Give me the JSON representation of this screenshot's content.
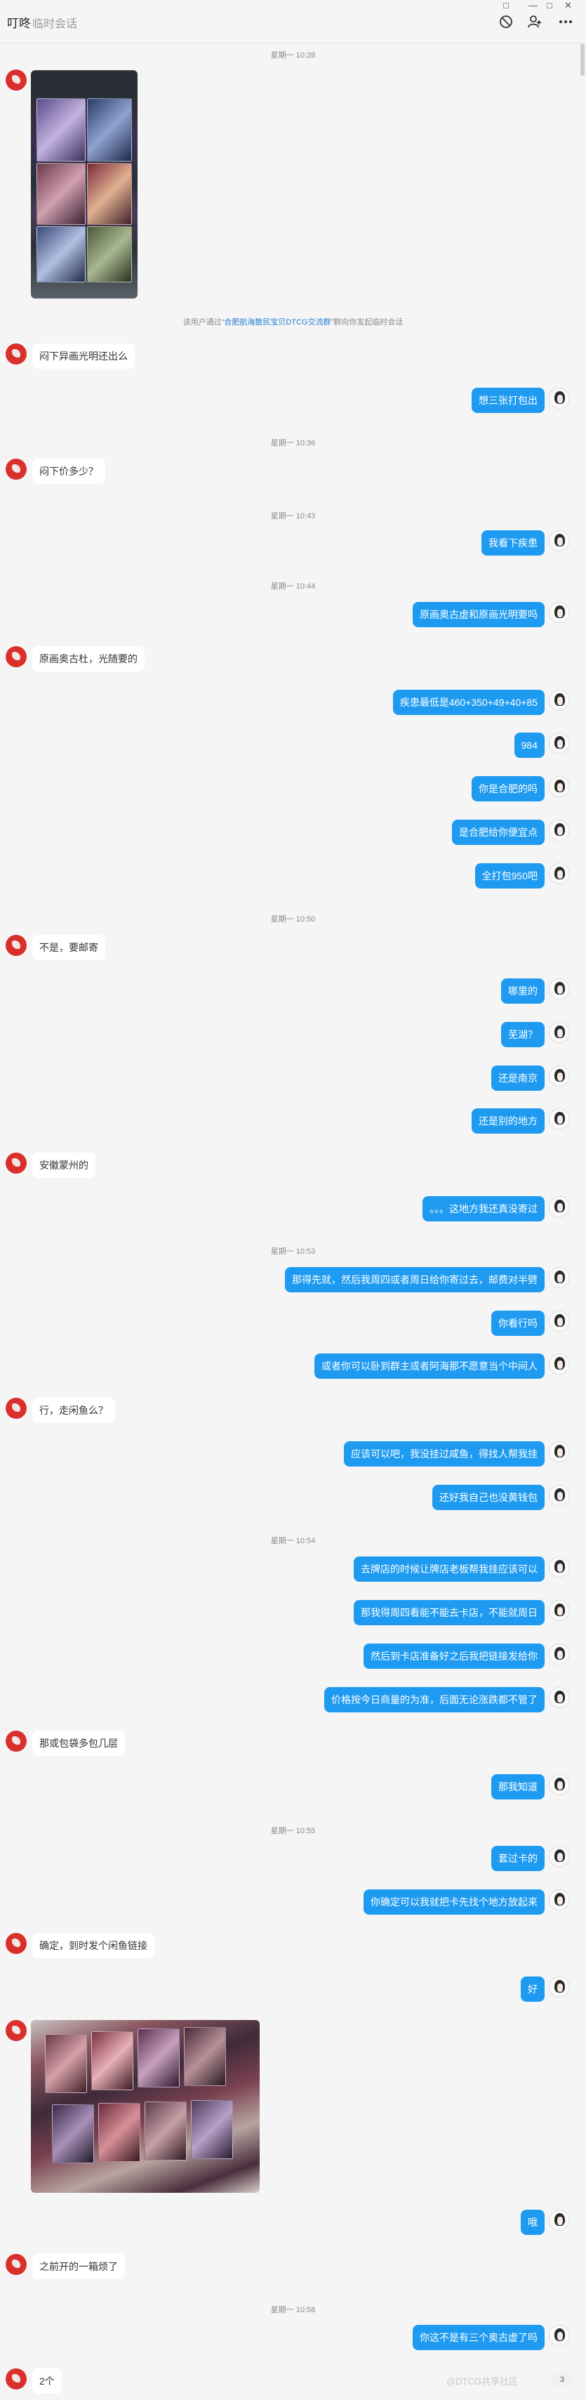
{
  "header": {
    "title": "叮咚",
    "subtitle": "临时会话",
    "window_controls": [
      "□",
      "—",
      "□",
      "✕"
    ]
  },
  "notice": {
    "pre": "该用户通过“",
    "group": "合肥航海散民宝贝DTCG交流群",
    "post": "”群向你发起临时会话"
  },
  "times": [
    "星期一 10:28",
    "星期一 10:36",
    "星期一 10:43",
    "星期一 10:44",
    "星期一 10:50",
    "星期一 10:53",
    "星期一 10:54",
    "星期一 10:55",
    "星期一 10:58"
  ],
  "messages": {
    "m1": "闷下异画光明还出么",
    "m2": "想三张打包出",
    "m3": "闷下价多少？",
    "m4": "我看下疾患",
    "m5": "原画奥古虚和原画光明要吗",
    "m6": "原画奥古杜，光随要的",
    "m7": "疾患最低是460+350+49+40+85",
    "m8": "984",
    "m9": "你是合肥的吗",
    "m10": "是合肥给你便宜点",
    "m11": "全打包950吧",
    "m12": "不是，要邮寄",
    "m13": "哪里的",
    "m14": "芜湖？",
    "m15": "还是南京",
    "m16": "还是别的地方",
    "m17": "安徽蒙州的",
    "m18": "。。。这地方我还真没寄过",
    "m19": "那得先就，然后我周四或者周日给你寄过去，邮费对半劈",
    "m20": "你看行吗",
    "m21": "或者你可以卧到群主或者阿海那不愿意当个中间人",
    "m22": "行，走闲鱼么？",
    "m23": "应该可以吧，我没挂过咸鱼，得找人帮我挂",
    "m24": "还好我自己也没黄钱包",
    "m25": "去牌店的时候让牌店老板帮我挂应该可以",
    "m26": "那我得周四看能不能去卡店，不能就周日",
    "m27": "然后到卡店准备好之后我把链接发给你",
    "m28": "价格按今日商量的为准，后面无论涨跌都不管了",
    "m29": "那或包袋多包几层",
    "m30": "那我知道",
    "m31": "套过卡的",
    "m32": "你确定可以我就把卡先找个地方放起来",
    "m33": "确定，到时发个闲鱼链接",
    "m34": "好",
    "m35": "哦",
    "m36": "之前开的一箱烦了",
    "m37": "你这不是有三个奥古虚了吗",
    "m38": "2个"
  },
  "watermark": "@DTCG共享社区",
  "badge": "3"
}
